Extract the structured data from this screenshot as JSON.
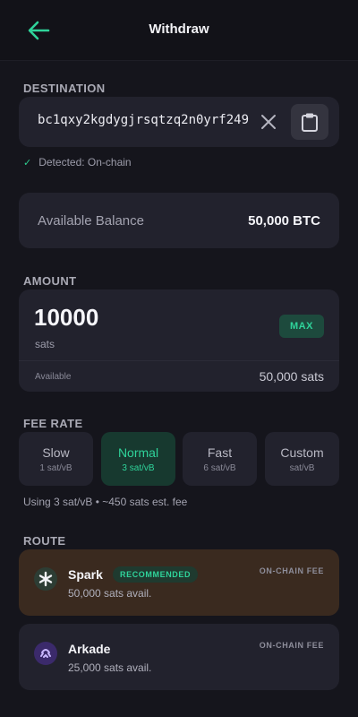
{
  "header": {
    "title": "Withdraw",
    "back_icon": "arrow-left-icon",
    "accent": "#2fd39a"
  },
  "destination": {
    "label": "DESTINATION",
    "address": "bc1qxy2kgdygjrsqtzq2n0yrf249",
    "clear_icon": "close-icon",
    "paste_icon": "clipboard-icon",
    "detected_check": "✓",
    "detected_text": "Detected: On-chain"
  },
  "balance": {
    "label": "Available Balance",
    "value": "50,000 BTC"
  },
  "amount": {
    "label": "AMOUNT",
    "value": "10000",
    "unit": "sats",
    "max_label": "MAX",
    "available_label": "Available",
    "available_value": "50,000 sats"
  },
  "fee": {
    "label": "FEE RATE",
    "options": [
      {
        "name": "Slow",
        "rate": "1 sat/vB",
        "active": false
      },
      {
        "name": "Normal",
        "rate": "3 sat/vB",
        "active": true
      },
      {
        "name": "Fast",
        "rate": "6 sat/vB",
        "active": false
      },
      {
        "name": "Custom",
        "rate": "sat/vB",
        "active": false
      }
    ],
    "note": "Using 3 sat/vB • ~450 sats est. fee"
  },
  "route": {
    "label": "ROUTE",
    "options": [
      {
        "name": "Spark",
        "badge": "RECOMMENDED",
        "sub": "50,000 sats avail.",
        "fee_label": "ON-CHAIN FEE",
        "icon": "spark-asterisk-icon"
      },
      {
        "name": "Arkade",
        "sub": "25,000 sats avail.",
        "fee_label": "ON-CHAIN FEE",
        "icon": "arkade-icon"
      }
    ]
  }
}
